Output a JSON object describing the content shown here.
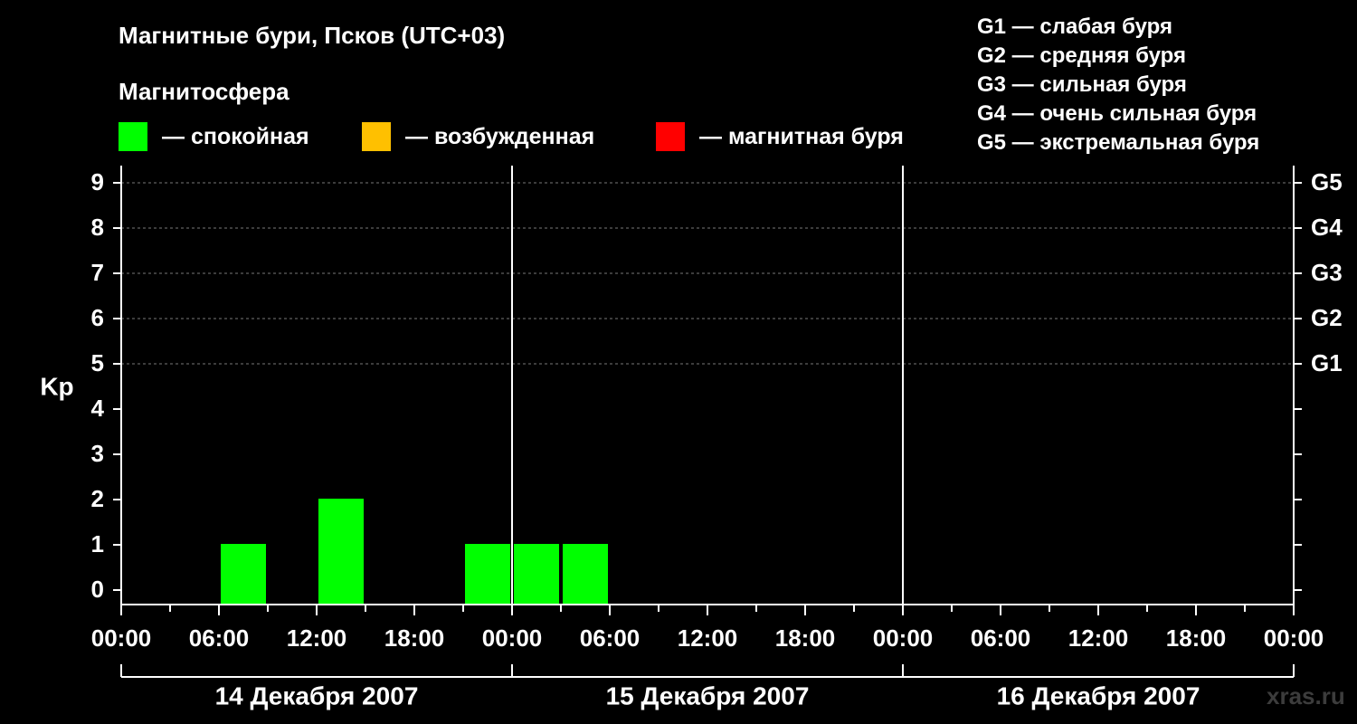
{
  "header": {
    "title": "Магнитные бури, Псков (UTC+03)",
    "subtitle": "Магнитосфера"
  },
  "legend": [
    {
      "label": "— спокойная",
      "color": "#00ff00"
    },
    {
      "label": "— возбужденная",
      "color": "#ffc000"
    },
    {
      "label": "— магнитная буря",
      "color": "#ff0000"
    }
  ],
  "g_legend": [
    "G1 — слабая буря",
    "G2 — средняя буря",
    "G3 — сильная буря",
    "G4 — очень сильная буря",
    "G5 — экстремальная буря"
  ],
  "watermark": "xras.ru",
  "chart_data": {
    "type": "bar",
    "ylabel": "Kp",
    "ylim": [
      0,
      9
    ],
    "y_ticks": [
      0,
      1,
      2,
      3,
      4,
      5,
      6,
      7,
      8,
      9
    ],
    "right_ticks": [
      {
        "y": 5,
        "label": "G1"
      },
      {
        "y": 6,
        "label": "G2"
      },
      {
        "y": 7,
        "label": "G3"
      },
      {
        "y": 8,
        "label": "G4"
      },
      {
        "y": 9,
        "label": "G5"
      }
    ],
    "x_hour_range": [
      0,
      72
    ],
    "x_tick_labels": [
      "00:00",
      "06:00",
      "12:00",
      "18:00",
      "00:00",
      "06:00",
      "12:00",
      "18:00",
      "00:00",
      "06:00",
      "12:00",
      "18:00",
      "00:00"
    ],
    "days": [
      "14 Декабря 2007",
      "15 Декабря 2007",
      "16 Декабря 2007"
    ],
    "grid": "dashed at G levels (Kp 5–9)",
    "series": [
      {
        "color": "#00ff00",
        "bars": [
          {
            "start": "14 Декабря 2007 06:00",
            "end": "14 Декабря 2007 09:00",
            "kp": 1
          },
          {
            "start": "14 Декабря 2007 12:00",
            "end": "14 Декабря 2007 15:00",
            "kp": 2
          },
          {
            "start": "14 Декабря 2007 21:00",
            "end": "15 Декабря 2007 00:00",
            "kp": 1
          },
          {
            "start": "15 Декабря 2007 00:00",
            "end": "15 Декабря 2007 03:00",
            "kp": 1
          },
          {
            "start": "15 Декабря 2007 03:00",
            "end": "15 Декабря 2007 06:00",
            "kp": 1
          }
        ]
      }
    ]
  }
}
